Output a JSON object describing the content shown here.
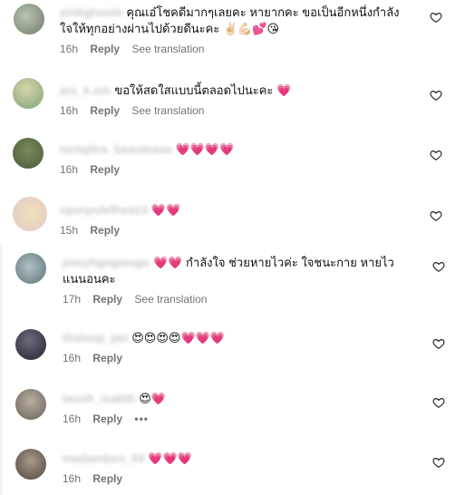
{
  "comments": [
    {
      "username": "pinkghoste",
      "text_line1": "คุณเอ๋โชคดีมากๆเลยคะ หายากคะ ขอเป็นอีกหนึ่งกำลัง",
      "text_line2": "ใจให้ทุกอย่างผ่านไปด้วยดีนะคะ ✌🏻💪🏻💕😘",
      "time": "16h",
      "reply": "Reply",
      "translation": "See translation",
      "avatar_color": "#7c8c7a"
    },
    {
      "username": "jeu_k.om",
      "text_line1": "ขอให้สดใสแบบนี้ตลอดไปนะคะ 💗",
      "text_line2": "",
      "time": "16h",
      "reply": "Reply",
      "translation": "See translation",
      "avatar_color": "#8fa98a"
    },
    {
      "username": "tortajitra_beauteaaa",
      "text_line1": "💗💗💗💗",
      "text_line2": "",
      "time": "16h",
      "reply": "Reply",
      "translation": "",
      "avatar_color": "#5e6e4e"
    },
    {
      "username": "npurpolefhea13",
      "text_line1": "💗💗",
      "text_line2": "",
      "time": "15h",
      "reply": "Reply",
      "translation": "",
      "avatar_color": "#e8d2c8"
    },
    {
      "username": "jomyhgngwogo",
      "text_line1": "💗💗 กำลังใจ ช่วยหายไวค่ะ ใจชนะกาย หายไว",
      "text_line2": "แนนอนคะ",
      "time": "17h",
      "reply": "Reply",
      "translation": "See translation",
      "avatar_color": "#8a9aa2"
    },
    {
      "username": "thaleop_jan",
      "text_line1": "😍😍😍😍💗💗💗",
      "text_line2": "",
      "time": "16h",
      "reply": "Reply",
      "translation": "",
      "avatar_color": "#3a3a4a"
    },
    {
      "username": "taush_isabth",
      "text_line1": "😍💗",
      "text_line2": "",
      "time": "16h",
      "reply": "Reply",
      "translation": "",
      "more": "•••",
      "avatar_color": "#7a7068"
    },
    {
      "username": "madamben_59",
      "text_line1": "💗💗💗",
      "text_line2": "",
      "time": "16h",
      "reply": "Reply",
      "translation": "",
      "avatar_color": "#6a6258"
    }
  ]
}
